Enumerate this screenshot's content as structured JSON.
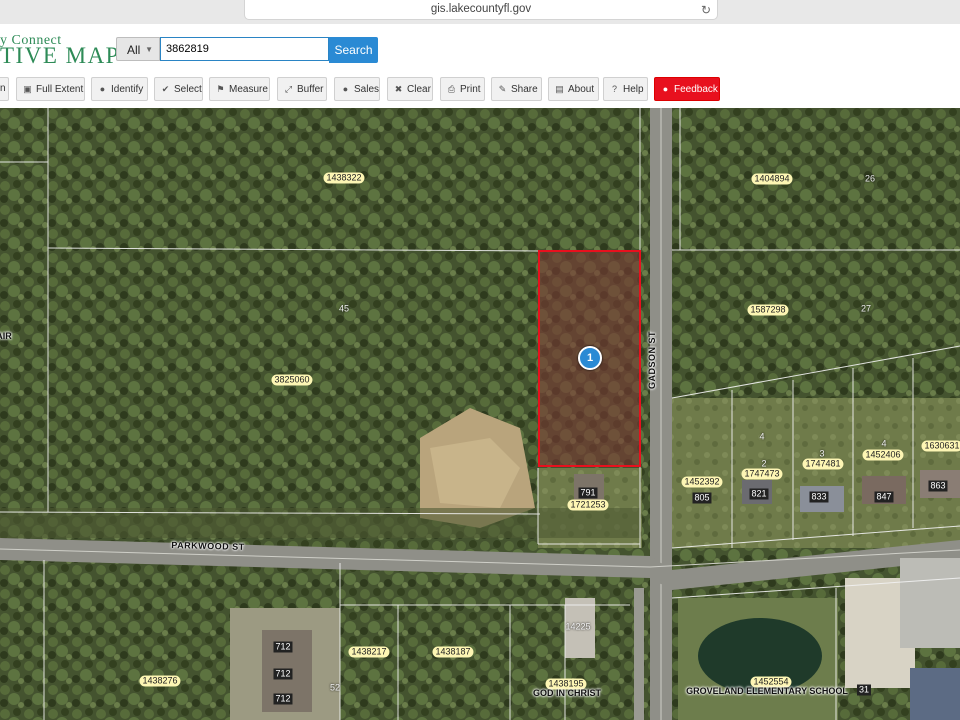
{
  "browser": {
    "url": "gis.lakecountyfl.gov"
  },
  "header": {
    "logo_line1": "y Connect",
    "logo_line2": "TIVE MAP",
    "search": {
      "category": "All",
      "value": "3862819",
      "button": "Search"
    }
  },
  "toolbar": {
    "items": [
      {
        "id": "n",
        "label": "n",
        "icon": "partial-icon"
      },
      {
        "id": "full-extent",
        "label": "Full Extent",
        "icon": "image-icon"
      },
      {
        "id": "identify",
        "label": "Identify",
        "icon": "info-icon"
      },
      {
        "id": "select",
        "label": "Select",
        "icon": "check-icon"
      },
      {
        "id": "measure",
        "label": "Measure",
        "icon": "flag-icon"
      },
      {
        "id": "buffer",
        "label": "Buffer",
        "icon": "arrows-icon"
      },
      {
        "id": "sales",
        "label": "Sales",
        "icon": "info-icon"
      },
      {
        "id": "clear",
        "label": "Clear",
        "icon": "close-icon"
      },
      {
        "id": "print",
        "label": "Print",
        "icon": "print-icon"
      },
      {
        "id": "share",
        "label": "Share",
        "icon": "share-icon"
      },
      {
        "id": "about",
        "label": "About",
        "icon": "comment-icon"
      },
      {
        "id": "help",
        "label": "Help",
        "icon": "question-icon"
      },
      {
        "id": "feedback",
        "label": "Feedback",
        "icon": "info-icon"
      }
    ]
  },
  "map": {
    "selected_marker": "1",
    "parcel_labels": [
      "1438322",
      "1404894",
      "3825060",
      "1587298",
      "1721253",
      "1452392",
      "1747473",
      "1747481",
      "1452406",
      "1630631",
      "1438217",
      "1438187",
      "1438276",
      "1438195",
      "1452554",
      "14225"
    ],
    "address_labels": [
      "26",
      "45",
      "27",
      "791",
      "805",
      "821",
      "833",
      "847",
      "863",
      "712",
      "712",
      "712",
      "52",
      "31",
      "4",
      "3",
      "2",
      "4"
    ],
    "street_labels": [
      "PARKWOOD ST",
      "GADSON ST"
    ],
    "landmark_labels": [
      "GROVELAND ELEMENTARY SCHOOL",
      "GOD IN CHRIST"
    ],
    "edge_fragments": [
      "AIR"
    ],
    "selected_parcel_color": "#e8101e"
  }
}
